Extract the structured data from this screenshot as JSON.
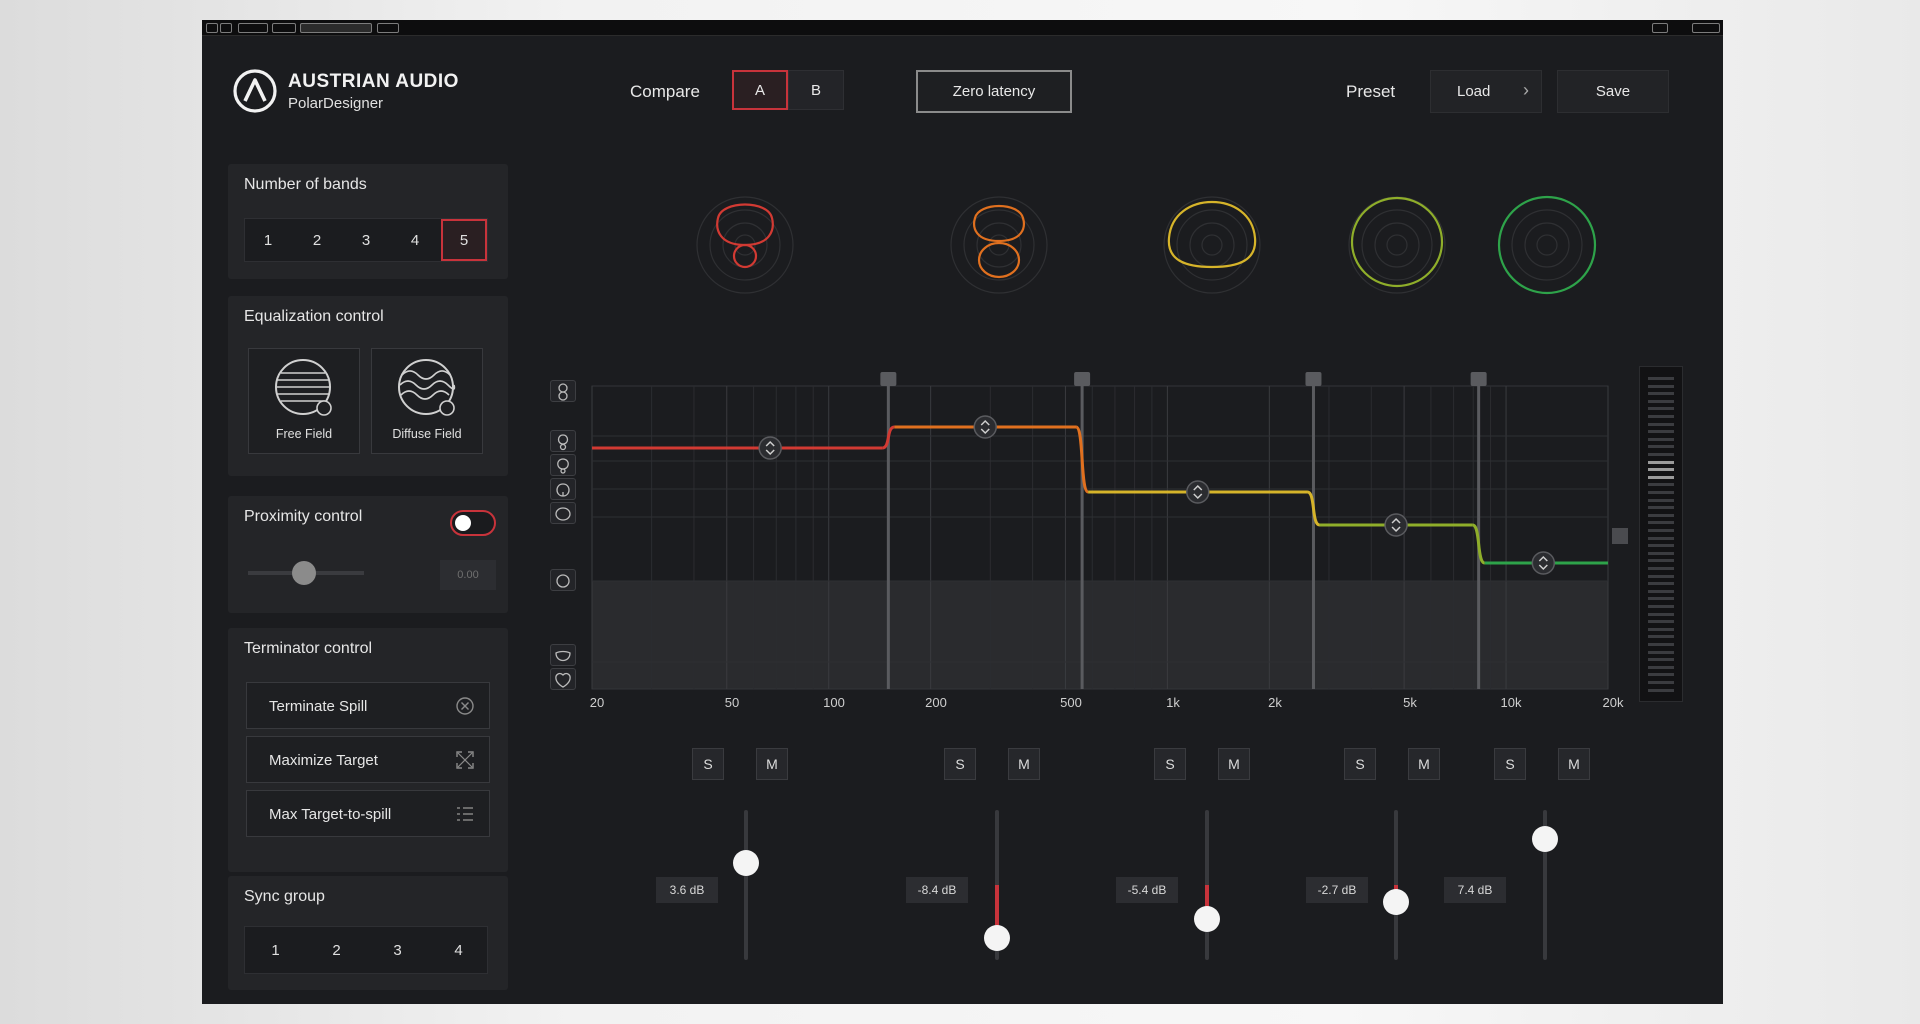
{
  "app": {
    "brand": "AUSTRIAN AUDIO",
    "product": "PolarDesigner"
  },
  "header": {
    "compare_label": "Compare",
    "compare_a": "A",
    "compare_b": "B",
    "compare_selected": "A",
    "zero_latency_label": "Zero latency",
    "preset_label": "Preset",
    "load_label": "Load",
    "save_label": "Save"
  },
  "bands_panel": {
    "title": "Number of bands",
    "options": [
      "1",
      "2",
      "3",
      "4",
      "5"
    ],
    "selected": "5"
  },
  "eq_panel": {
    "title": "Equalization control",
    "free_field_label": "Free Field",
    "diffuse_field_label": "Diffuse Field"
  },
  "proximity_panel": {
    "title": "Proximity control",
    "toggle_on": false,
    "slider_fraction": 0.4,
    "value": "0.00"
  },
  "terminator_panel": {
    "title": "Terminator control",
    "terminate_spill_label": "Terminate Spill",
    "maximize_target_label": "Maximize Target",
    "max_target_to_spill_label": "Max Target-to-spill"
  },
  "sync_panel": {
    "title": "Sync group",
    "options": [
      "1",
      "2",
      "3",
      "4"
    ]
  },
  "graph": {
    "x_ticks": [
      "20",
      "50",
      "100",
      "200",
      "500",
      "1k",
      "2k",
      "5k",
      "10k",
      "20k"
    ],
    "band_colors": [
      "#d23a33",
      "#e0701f",
      "#d6b42a",
      "#8fae2a",
      "#2ea34a"
    ],
    "crossovers_hz": [
      150,
      560,
      2700,
      8300
    ]
  },
  "bands": [
    {
      "solo": "S",
      "mute": "M",
      "gain_text": "3.6 dB",
      "gain_db": 3.6,
      "color": "#d23a33"
    },
    {
      "solo": "S",
      "mute": "M",
      "gain_text": "-8.4 dB",
      "gain_db": -8.4,
      "color": "#e0701f"
    },
    {
      "solo": "S",
      "mute": "M",
      "gain_text": "-5.4 dB",
      "gain_db": -5.4,
      "color": "#d6b42a"
    },
    {
      "solo": "S",
      "mute": "M",
      "gain_text": "-2.7 dB",
      "gain_db": -2.7,
      "color": "#8fae2a"
    },
    {
      "solo": "S",
      "mute": "M",
      "gain_text": "7.4 dB",
      "gain_db": 7.4,
      "color": "#2ea34a"
    }
  ],
  "colors": {
    "accent_red": "#c8333b",
    "background": "#1b1c1f",
    "panel": "#242528"
  },
  "icons": {
    "terminate_spill": "circle-x-icon",
    "maximize_target": "expand-arrows-icon",
    "max_target_to_spill": "list-icon"
  }
}
